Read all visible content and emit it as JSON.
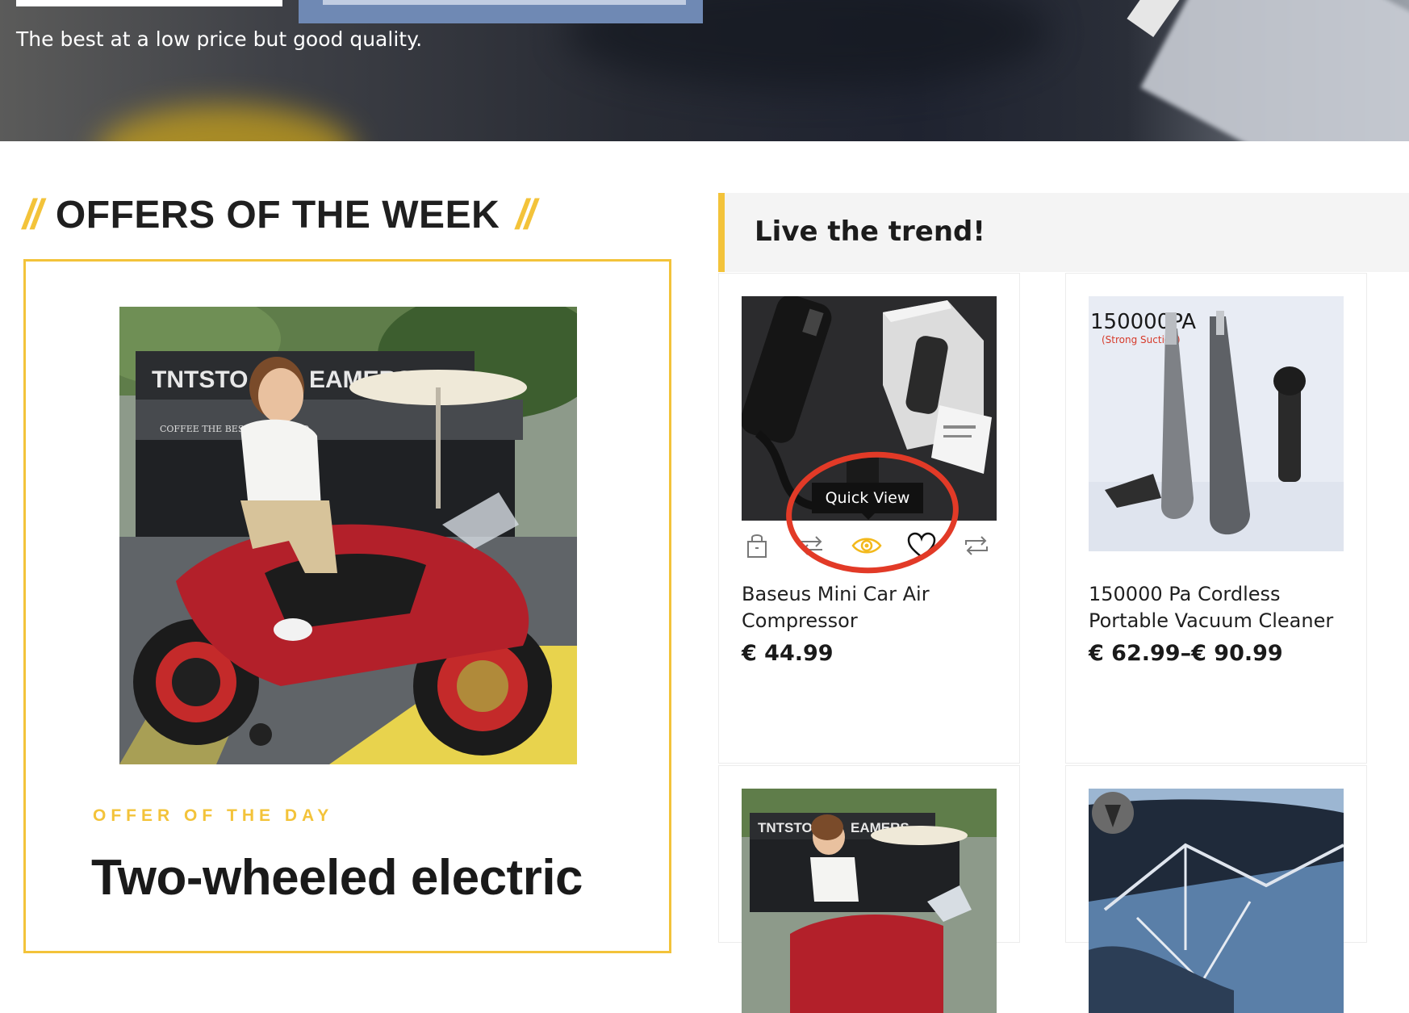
{
  "hero": {
    "subtitle": "The best at a low price but good quality."
  },
  "offers": {
    "heading": "OFFERS OF THE WEEK",
    "slashes_left": "//",
    "slashes_right": "//",
    "kicker": "OFFER OF THE DAY",
    "title": "Two-wheeled electric"
  },
  "trend": {
    "heading": "Live the trend!",
    "tooltip": "Quick View",
    "products": [
      {
        "name": "Baseus Mini Car Air Compressor",
        "price": "€ 44.99"
      },
      {
        "name": "150000 Pa Cordless Portable Vacuum Cleaner",
        "price": "€ 62.99–€ 90.99",
        "image_text": "150000PA",
        "image_subtext": "(Strong Suction)"
      }
    ]
  },
  "offer_image_text": {
    "sign_left": "TNTSTO",
    "sign_right": "EAMERS",
    "awning": "COFFEE THE BEST WE CAN DO"
  },
  "colors": {
    "accent": "#f3c33a",
    "annotation": "#e23a27",
    "highlight": "#6f89b4"
  },
  "icons": [
    "cart-icon",
    "compare-icon",
    "eye-icon",
    "heart-icon",
    "repeat-icon"
  ]
}
